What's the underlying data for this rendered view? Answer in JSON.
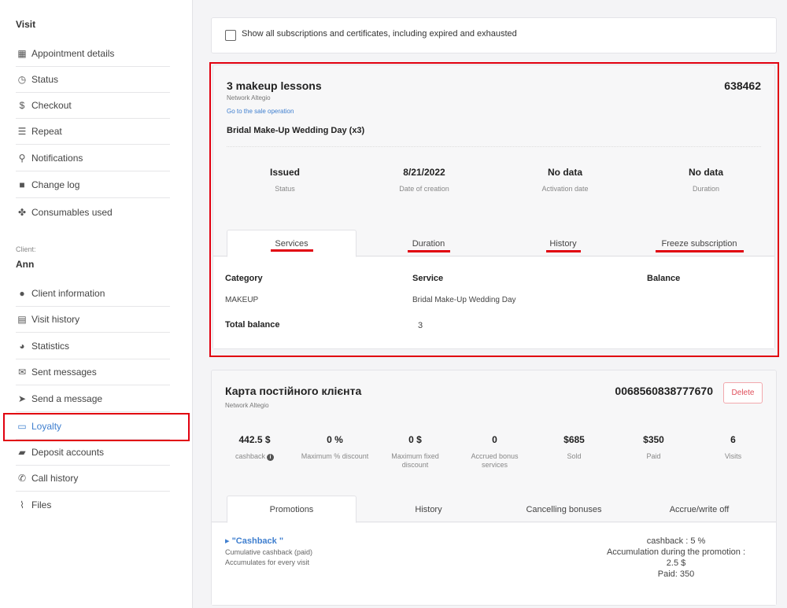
{
  "sidebar": {
    "visit_heading": "Visit",
    "visit_items": [
      {
        "icon": "calendar-icon",
        "glyph": "▦",
        "label": "Appointment details"
      },
      {
        "icon": "clock-icon",
        "glyph": "◷",
        "label": "Status"
      },
      {
        "icon": "dollar-icon",
        "glyph": "$",
        "label": "Checkout"
      },
      {
        "icon": "list-icon",
        "glyph": "☰",
        "label": "Repeat"
      },
      {
        "icon": "notification-icon",
        "glyph": "⚲",
        "label": "Notifications"
      },
      {
        "icon": "file-icon",
        "glyph": "■",
        "label": "Change log"
      },
      {
        "icon": "consumables-icon",
        "glyph": "✤",
        "label": "Consumables used"
      }
    ],
    "client_caption": "Client:",
    "client_name": "Ann",
    "client_items": [
      {
        "icon": "user-icon",
        "glyph": "●",
        "label": "Client information"
      },
      {
        "icon": "visit-history-icon",
        "glyph": "▤",
        "label": "Visit history"
      },
      {
        "icon": "pie-chart-icon",
        "glyph": "◕",
        "label": "Statistics"
      },
      {
        "icon": "envelope-icon",
        "glyph": "✉",
        "label": "Sent messages"
      },
      {
        "icon": "send-icon",
        "glyph": "➤",
        "label": "Send a message"
      },
      {
        "icon": "credit-card-icon",
        "glyph": "▭",
        "label": "Loyalty"
      },
      {
        "icon": "briefcase-icon",
        "glyph": "▰",
        "label": "Deposit accounts"
      },
      {
        "icon": "phone-icon",
        "glyph": "✆",
        "label": "Call history"
      },
      {
        "icon": "paperclip-icon",
        "glyph": "⌇",
        "label": "Files"
      }
    ]
  },
  "filter": {
    "checked": false,
    "label": "Show all subscriptions and certificates, including expired and exhausted"
  },
  "subscription": {
    "title": "3 makeup lessons",
    "number": "638462",
    "network": "Network Altegio",
    "sale_link": "Go to the sale operation",
    "service_title": "Bridal Make-Up Wedding Day (x3)",
    "stats": [
      {
        "value": "Issued",
        "label": "Status"
      },
      {
        "value": "8/21/2022",
        "label": "Date of creation"
      },
      {
        "value": "No data",
        "label": "Activation date"
      },
      {
        "value": "No data",
        "label": "Duration"
      }
    ],
    "tabs": [
      "Services",
      "Duration",
      "History",
      "Freeze subscription"
    ],
    "table": {
      "headers": [
        "Category",
        "Service",
        "Balance"
      ],
      "rows": [
        [
          "MAKEUP",
          "Bridal Make-Up Wedding Day",
          ""
        ]
      ],
      "total_label": "Total balance",
      "total_value": "3"
    }
  },
  "loyalty_card": {
    "title": "Карта постійного клієнта",
    "number": "0068560838777670",
    "delete_label": "Delete",
    "network": "Network Altegio",
    "stats": [
      {
        "value": "442.5 $",
        "label": "cashback"
      },
      {
        "value": "0 %",
        "label": "Maximum % discount"
      },
      {
        "value": "0 $",
        "label": "Maximum fixed discount"
      },
      {
        "value": "0",
        "label": "Accrued bonus services"
      },
      {
        "value": "$685",
        "label": "Sold"
      },
      {
        "value": "$350",
        "label": "Paid"
      },
      {
        "value": "6",
        "label": "Visits"
      }
    ],
    "tabs": [
      "Promotions",
      "History",
      "Cancelling bonuses",
      "Accrue/write off"
    ],
    "promotion": {
      "name": "▸ \"Cashback \"",
      "line1": "Cumulative cashback (paid)",
      "line2": "Accumulates for every visit",
      "right1": "cashback : 5 %",
      "right2": "Accumulation during the promotion :",
      "right3": "2.5 $",
      "right4": "Paid: 350"
    }
  }
}
